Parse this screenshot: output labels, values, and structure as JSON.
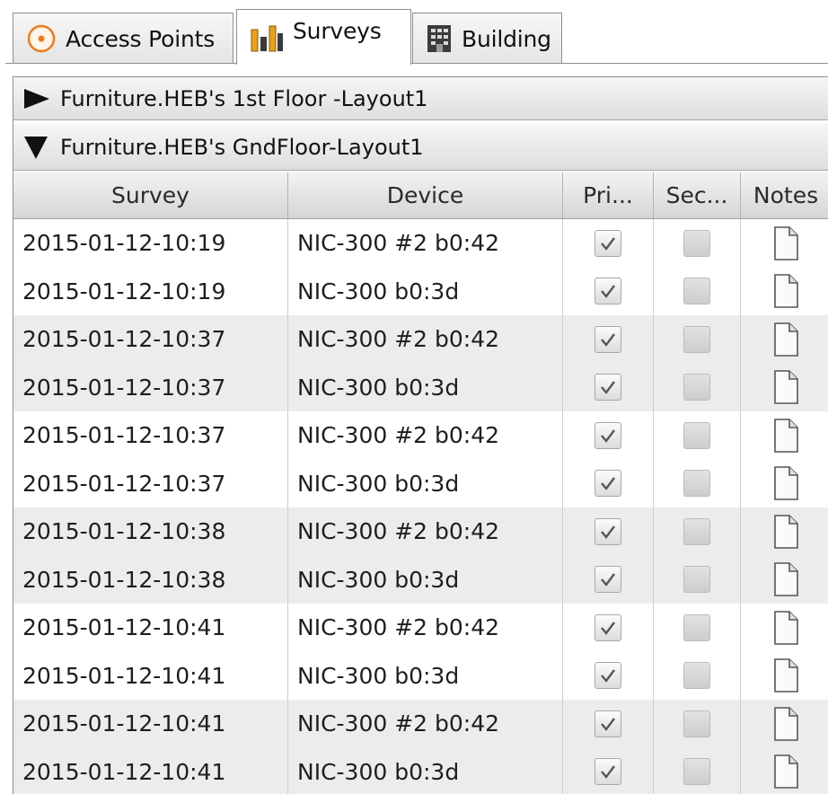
{
  "tabs": [
    {
      "label": "Access Points",
      "icon": "access-point-icon",
      "active": false
    },
    {
      "label": "Surveys",
      "icon": "survey-bars-icon",
      "active": true
    },
    {
      "label": "Building",
      "icon": "building-icon",
      "active": false
    }
  ],
  "groups": [
    {
      "label": "Furniture.HEB's 1st Floor -Layout1",
      "expanded": false
    },
    {
      "label": "Furniture.HEB's GndFloor-Layout1",
      "expanded": true
    }
  ],
  "table": {
    "columns": [
      "Survey",
      "Device",
      "Pri...",
      "Sec...",
      "Notes"
    ],
    "rows": [
      {
        "survey": "2015-01-12-10:19",
        "device": "NIC-300 #2 b0:42",
        "primary": true,
        "secondary": false
      },
      {
        "survey": "2015-01-12-10:19",
        "device": "NIC-300 b0:3d",
        "primary": true,
        "secondary": false
      },
      {
        "survey": "2015-01-12-10:37",
        "device": "NIC-300 #2 b0:42",
        "primary": true,
        "secondary": false
      },
      {
        "survey": "2015-01-12-10:37",
        "device": "NIC-300 b0:3d",
        "primary": true,
        "secondary": false
      },
      {
        "survey": "2015-01-12-10:37",
        "device": "NIC-300 #2 b0:42",
        "primary": true,
        "secondary": false
      },
      {
        "survey": "2015-01-12-10:37",
        "device": "NIC-300 b0:3d",
        "primary": true,
        "secondary": false
      },
      {
        "survey": "2015-01-12-10:38",
        "device": "NIC-300 #2 b0:42",
        "primary": true,
        "secondary": false
      },
      {
        "survey": "2015-01-12-10:38",
        "device": "NIC-300 b0:3d",
        "primary": true,
        "secondary": false
      },
      {
        "survey": "2015-01-12-10:41",
        "device": "NIC-300 #2 b0:42",
        "primary": true,
        "secondary": false
      },
      {
        "survey": "2015-01-12-10:41",
        "device": "NIC-300 b0:3d",
        "primary": true,
        "secondary": false
      },
      {
        "survey": "2015-01-12-10:41",
        "device": "NIC-300 #2 b0:42",
        "primary": true,
        "secondary": false
      },
      {
        "survey": "2015-01-12-10:41",
        "device": "NIC-300 b0:3d",
        "primary": true,
        "secondary": false
      }
    ]
  },
  "colors": {
    "access_point_accent": "#f07a1a",
    "survey_bars": "#e6a21c",
    "building": "#3b3b3b",
    "row_shade": "#ececec",
    "check_mark": "#555555"
  }
}
